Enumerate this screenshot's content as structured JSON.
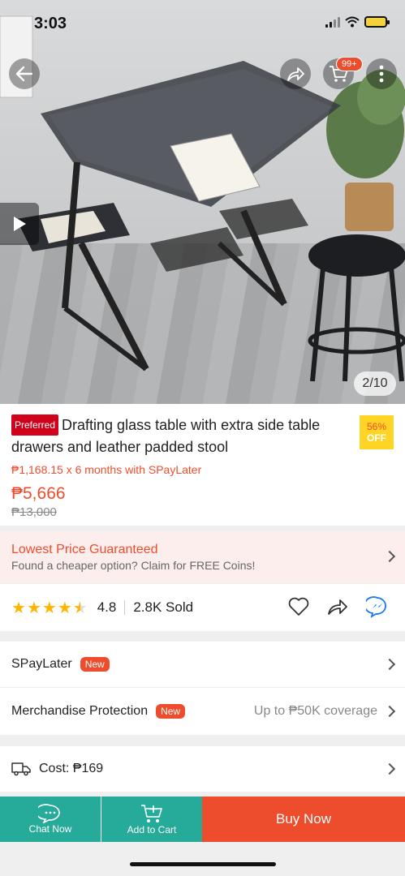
{
  "status": {
    "time": "3:03"
  },
  "hero": {
    "image_counter": "2/10",
    "cart_count": "99+"
  },
  "product": {
    "preferred_label": "Preferred",
    "title": "Drafting glass table with extra side table drawers and leather padded stool",
    "discount_pct": "56%",
    "discount_off": "OFF",
    "spaylater_line": "₱1,168.15 x 6 months with SPayLater",
    "price": "₱5,666",
    "old_price": "₱13,000"
  },
  "guarantee": {
    "title": "Lowest Price Guaranteed",
    "subtitle": "Found a cheaper option? Claim for FREE Coins!"
  },
  "rating": {
    "value": "4.8",
    "stars": 4.5,
    "sold": "2.8K Sold"
  },
  "rows": {
    "spaylater": {
      "label": "SPayLater",
      "badge": "New"
    },
    "protection": {
      "label": "Merchandise Protection",
      "badge": "New",
      "right": "Up to ₱50K coverage"
    },
    "shipping": {
      "label": "Cost: ₱169"
    }
  },
  "bottom_bar": {
    "chat": "Chat Now",
    "cart": "Add to Cart",
    "buy": "Buy Now"
  },
  "colors": {
    "accent": "#ee4d2d",
    "teal": "#26aa99",
    "star": "#ffb400"
  }
}
